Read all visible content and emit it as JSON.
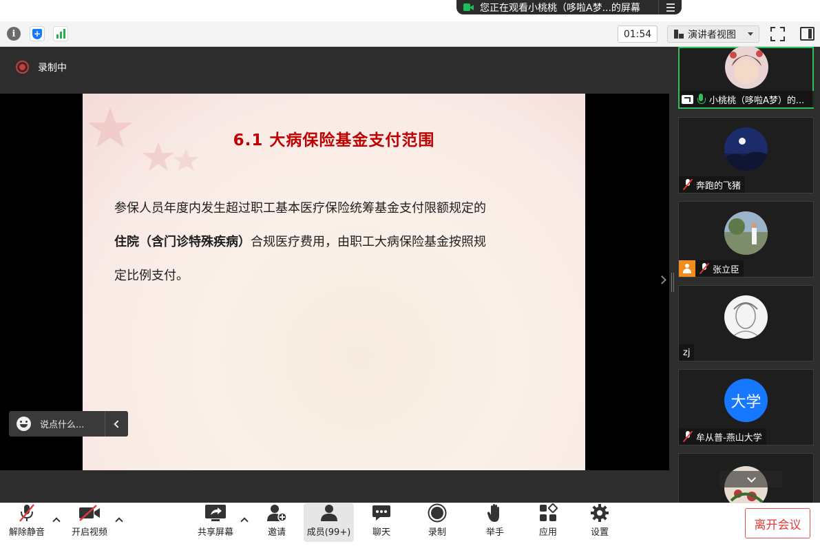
{
  "share_banner": {
    "text": "您正在观看小桃桃（哆啦A梦...的屏幕"
  },
  "toolbar": {
    "timer": "01:54",
    "view_mode": "演讲者视图"
  },
  "recording": {
    "label": "录制中"
  },
  "slide": {
    "title": "6.1  大病保险基金支付范围",
    "line1": "参保人员年度内发生超过职工基本医疗保险统筹基金支付限额规定的",
    "line2_bold": "住院（含门诊特殊疾病）",
    "line2_rest": "合规医疗费用，由职工大病保险基金按照规",
    "line3": "定比例支付。"
  },
  "comment": {
    "placeholder": "说点什么..."
  },
  "participants": [
    {
      "name": "小桃桃（哆啦A梦）的...",
      "status": "speaking-sharing"
    },
    {
      "name": "奔跑的飞猪",
      "status": "muted"
    },
    {
      "name": "张立臣",
      "status": "muted-host"
    },
    {
      "name": "zj",
      "status": "no-audio"
    },
    {
      "name": "牟从普-燕山大学",
      "avatar_text": "大学",
      "status": "muted"
    }
  ],
  "bottom_toolbar": {
    "unmute": "解除静音",
    "start_video": "开启视频",
    "share_screen": "共享屏幕",
    "invite": "邀请",
    "members": "成员(99+)",
    "chat": "聊天",
    "record": "录制",
    "raise_hand": "举手",
    "apps": "应用",
    "settings": "设置",
    "leave": "离开会议"
  },
  "colors": {
    "accent_green": "#2fbf5b",
    "title_red": "#c00000",
    "leave_red": "#e03a3a",
    "avatar_blue": "#1677ff"
  }
}
